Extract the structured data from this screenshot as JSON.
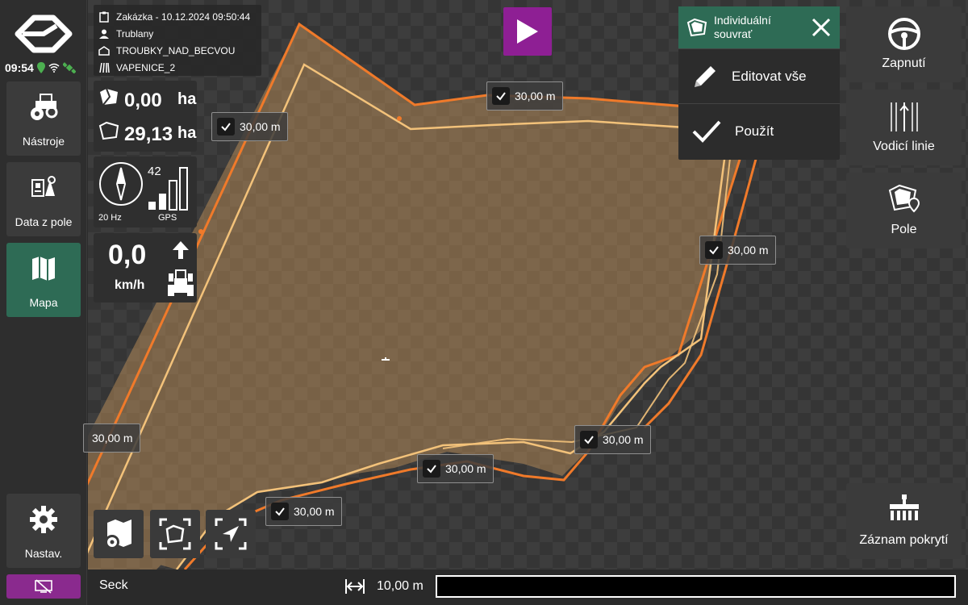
{
  "status": {
    "time": "09:54"
  },
  "nav": {
    "tools_label": "Nástroje",
    "field_data_label": "Data z pole",
    "map_label": "Mapa",
    "settings_label": "Nastav."
  },
  "job": {
    "order": "Zakázka - 10.12.2024 09:50:44",
    "operator": "Trublany",
    "farm": "TROUBKY_NAD_BECVOU",
    "field": "VAPENICE_2"
  },
  "area": {
    "worked_value": "0,00",
    "total_value": "29,13",
    "unit": "ha"
  },
  "gps": {
    "satellites": "42",
    "rate": "20 Hz",
    "label": "GPS"
  },
  "speed": {
    "value": "0,0",
    "unit": "km/h"
  },
  "headland": {
    "title_line1": "Individuální",
    "title_line2": "souvrať",
    "edit_all": "Editovat vše",
    "apply": "Použít"
  },
  "right": {
    "steer_label": "Zapnutí",
    "guidance_label": "Vodicí linie",
    "field_label": "Pole",
    "coverage_label": "Záznam pokrytí"
  },
  "chips": {
    "c1": "30,00 m",
    "c2": "30,00 m",
    "c3": "30,00 m",
    "c4": "30,00 m",
    "c5": "30,00 m",
    "c6": "30,00 m",
    "c7": "30,00 m"
  },
  "bottom": {
    "section": "Seck",
    "width": "10,00 m"
  },
  "colors": {
    "accent_green": "#2e6b55",
    "accent_purple": "#8e1f94",
    "boundary_orange": "#f07a2a",
    "inner_line": "#f3c27a"
  }
}
